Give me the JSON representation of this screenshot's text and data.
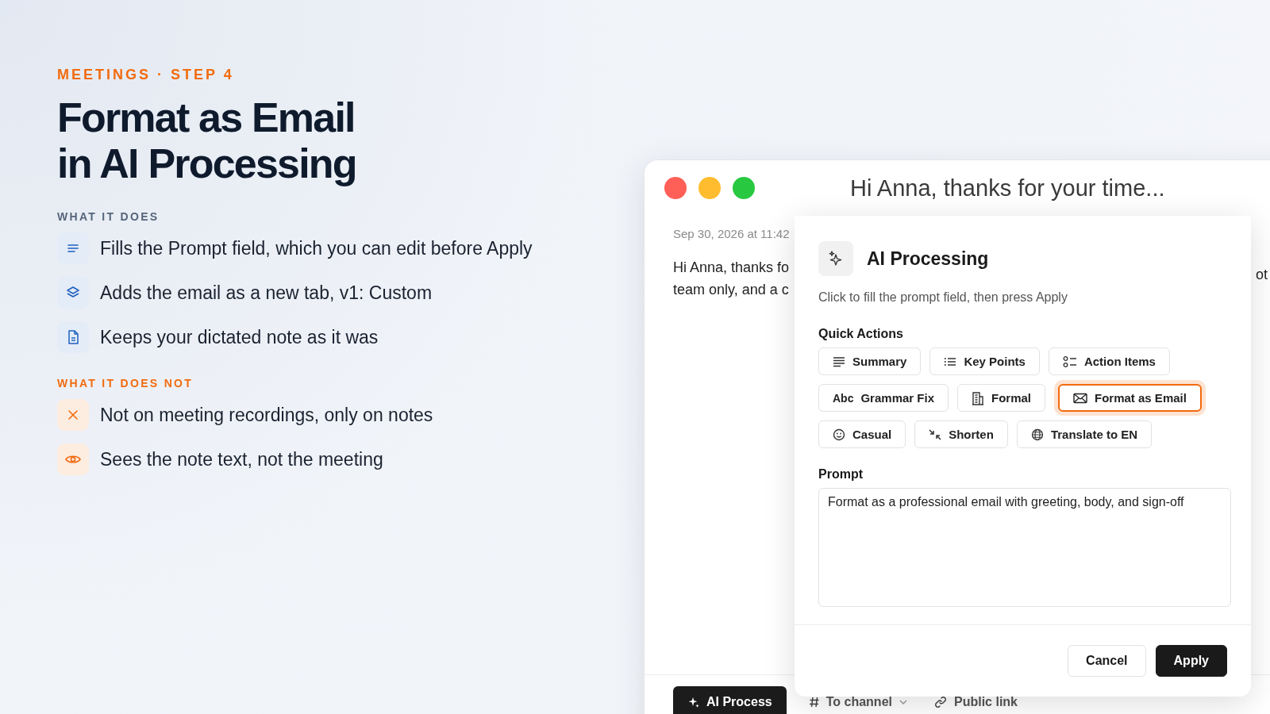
{
  "eyebrow": "MEETINGS · STEP 4",
  "heading": [
    "Format as Email",
    "in AI Processing"
  ],
  "does": {
    "title": "WHAT IT DOES",
    "items": [
      "Fills the Prompt field, which you can edit before Apply",
      "Adds the email as a new tab, v1: Custom",
      "Keeps your dictated note as it was"
    ]
  },
  "does_not": {
    "title": "WHAT IT DOES NOT",
    "items": [
      "Not on meeting recordings, only on notes",
      "Sees the note text, not the meeting"
    ]
  },
  "window": {
    "title": "Hi Anna, thanks for your time...",
    "note": {
      "date": "Sep 30, 2026 at 11:42",
      "lines": [
        "Hi Anna, thanks fo",
        "team only, and a c"
      ],
      "line_1_end": "ot"
    },
    "toolbar": [
      {
        "label": "AI Process",
        "kind": "primary"
      },
      {
        "label": "To channel",
        "kind": "dropdown"
      },
      {
        "label": "Public link",
        "kind": "link"
      }
    ]
  },
  "dialog": {
    "title": "AI Processing",
    "subtitle": "Click to fill the prompt field, then press Apply",
    "quick_actions_label": "Quick Actions",
    "quick_actions": [
      [
        {
          "label": "Summary",
          "selected": false
        },
        {
          "label": "Key Points",
          "selected": false
        },
        {
          "label": "Action Items",
          "selected": false
        }
      ],
      [
        {
          "label": "Grammar Fix",
          "selected": false,
          "prefix": "Abc"
        },
        {
          "label": "Formal",
          "selected": false
        },
        {
          "label": "Format as Email",
          "selected": true
        }
      ],
      [
        {
          "label": "Casual",
          "selected": false
        },
        {
          "label": "Shorten",
          "selected": false
        },
        {
          "label": "Translate to EN",
          "selected": false
        }
      ]
    ],
    "prompt_label": "Prompt",
    "prompt": "Format as a professional email with greeting, body, and sign-off",
    "buttons": [
      {
        "label": "Cancel",
        "kind": "secondary"
      },
      {
        "label": "Apply",
        "kind": "primary"
      }
    ]
  }
}
